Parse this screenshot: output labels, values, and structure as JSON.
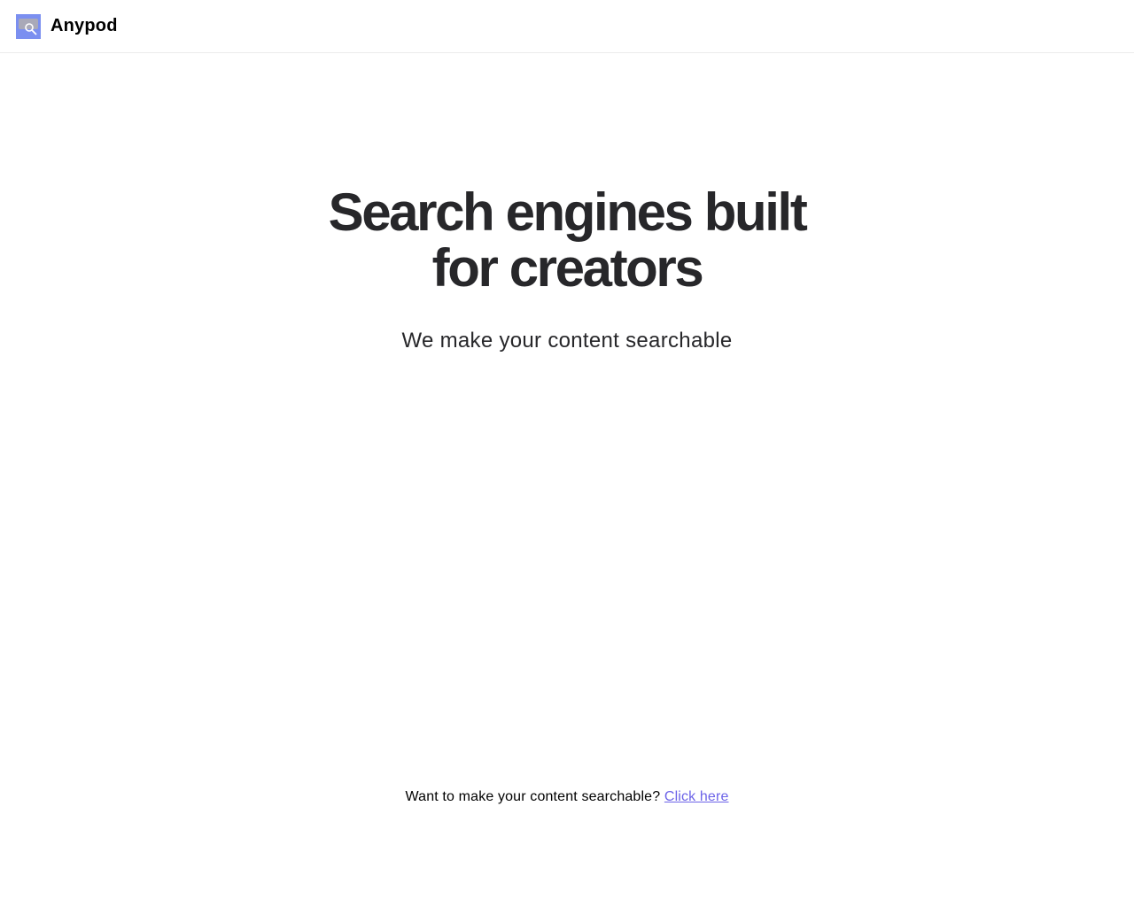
{
  "header": {
    "brand": "Anypod",
    "logo_icon": "search-logo-icon",
    "logo_color": "#7b8ff0"
  },
  "hero": {
    "title_line1": "Search engines built",
    "title_line2": "for creators",
    "subtitle": "We make your content searchable"
  },
  "footer": {
    "prompt": "Want to make your content searchable?",
    "link_label": "Click here",
    "link_color": "#6c63e8"
  }
}
